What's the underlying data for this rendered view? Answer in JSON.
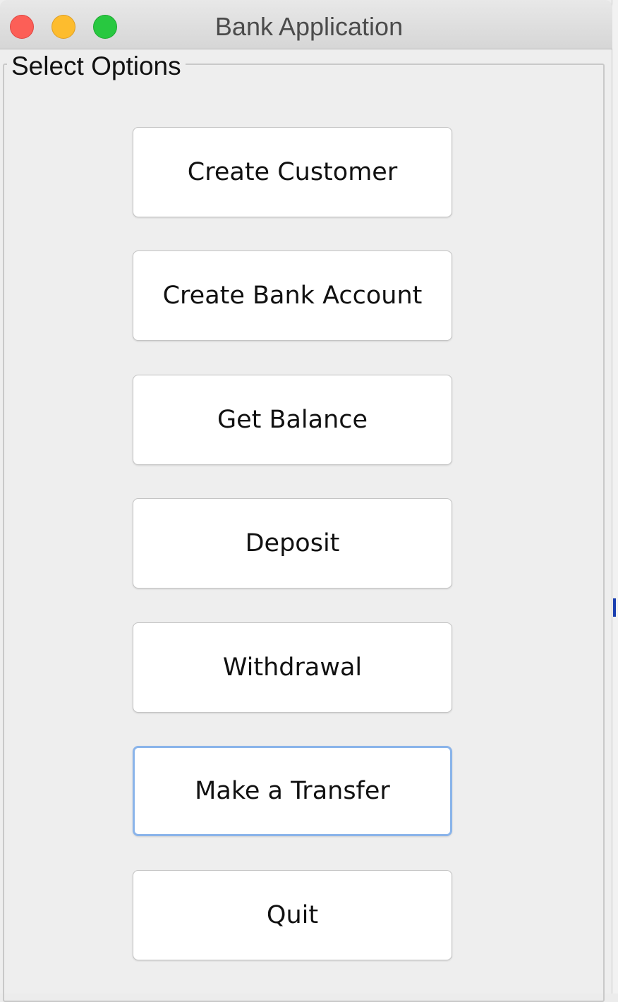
{
  "window": {
    "title": "Bank Application"
  },
  "traffic_lights": {
    "close": "close-icon",
    "minimize": "minimize-icon",
    "zoom": "zoom-icon"
  },
  "panel": {
    "group_title": "Select Options",
    "focused_button": "Make a Transfer",
    "buttons": [
      {
        "label": "Create Customer"
      },
      {
        "label": "Create Bank Account"
      },
      {
        "label": "Get Balance"
      },
      {
        "label": "Deposit"
      },
      {
        "label": "Withdrawal"
      },
      {
        "label": "Make a Transfer"
      },
      {
        "label": "Quit"
      }
    ]
  },
  "colors": {
    "focus_ring": "#8ab4ea",
    "close": "#fc5f57",
    "minimize": "#fdbc2e",
    "zoom": "#28c840"
  }
}
